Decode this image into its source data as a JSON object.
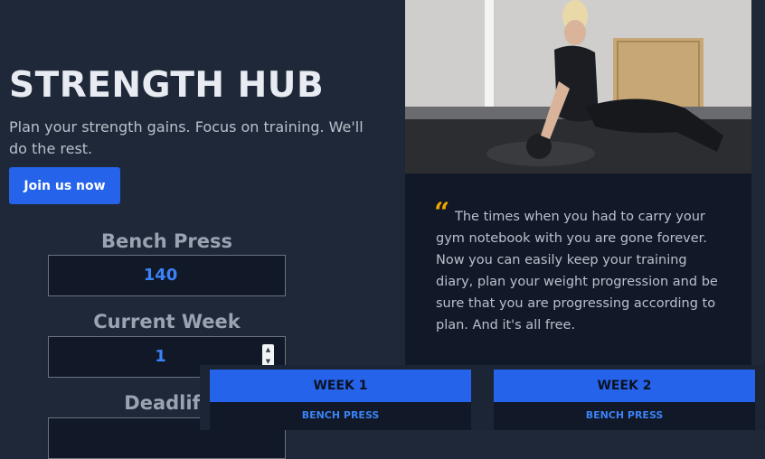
{
  "hero": {
    "title": "STRENGTH HUB",
    "subtitle": "Plan your strength gains. Focus on training. We'll do the rest.",
    "join_label": "Join us now"
  },
  "fields": {
    "bench": {
      "label": "Bench Press",
      "value": "140"
    },
    "week": {
      "label": "Current Week",
      "value": "1"
    },
    "deadlift": {
      "label": "Deadlift",
      "value": ""
    }
  },
  "testimonial": {
    "quote_mark": "“",
    "text": "The times when you had to carry your gym notebook with you are gone forever. Now you can easily keep your training diary, plan your weight progression and be sure that you are progressing according to plan. And it's all free."
  },
  "weeks": [
    {
      "title": "WEEK 1",
      "exercise": "BENCH PRESS"
    },
    {
      "title": "WEEK 2",
      "exercise": "BENCH PRESS"
    }
  ],
  "colors": {
    "background": "#1f2838",
    "panel": "#111827",
    "accent": "#2563eb",
    "value_blue": "#3b82f6",
    "quote_gold": "#f0a500"
  },
  "icons": {
    "spinner_up": "▲",
    "spinner_down": "▼"
  }
}
